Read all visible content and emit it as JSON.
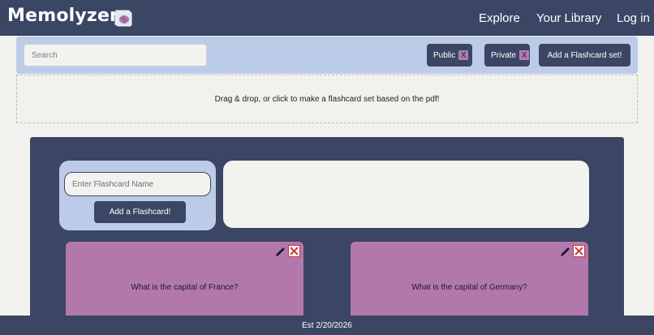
{
  "app": {
    "title": "Memolyzer",
    "logo_icon": "brain-book-icon"
  },
  "nav": {
    "items": [
      {
        "label": "Explore"
      },
      {
        "label": "Your Library"
      },
      {
        "label": "Log in"
      }
    ]
  },
  "toolbar": {
    "search_placeholder": "Search",
    "filters": [
      {
        "label": "Public",
        "remove": "X"
      },
      {
        "label": "Private",
        "remove": "X"
      }
    ],
    "add_set_label": "Add a Flashcard set!"
  },
  "dropzone": {
    "text": "Drag & drop, or click to make a flashcard set based on the pdf!"
  },
  "creator": {
    "name_placeholder": "Enter Flashcard Name",
    "add_label": "Add a Flashcard!"
  },
  "cards": [
    {
      "question": "What is the capital of France?",
      "edit_icon": "pencil-icon",
      "delete_icon": "close-icon"
    },
    {
      "question": "What is the capital of Germany?",
      "edit_icon": "pencil-icon",
      "delete_icon": "close-icon"
    }
  ],
  "footer": {
    "text": "Est 2/20/2026"
  },
  "colors": {
    "header": "#3a4664",
    "toolbar": "#bccce8",
    "card": "#b378ab",
    "background": "#f1f2ee"
  }
}
